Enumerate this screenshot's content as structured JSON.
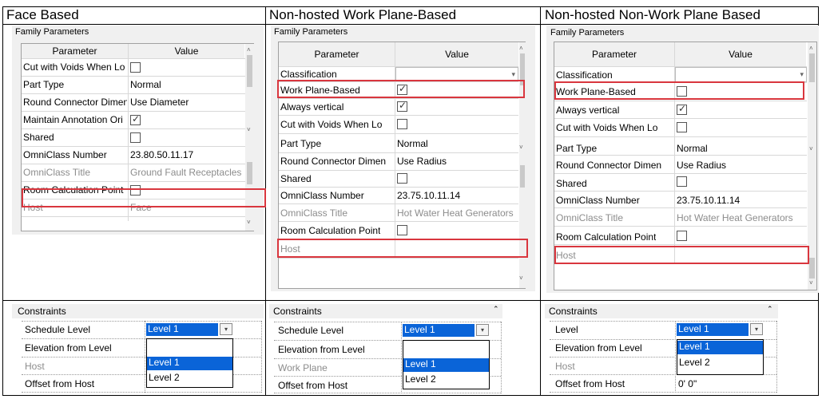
{
  "columns": [
    {
      "heading": "Face Based"
    },
    {
      "heading": "Non-hosted Work Plane-Based"
    },
    {
      "heading": "Non-hosted Non-Work Plane Based"
    }
  ],
  "family_parameters": {
    "panel_title": "Family Parameters",
    "header_parameter": "Parameter",
    "header_value": "Value",
    "check_glyph": "✓",
    "face_based": {
      "rows": [
        {
          "name": "Cut with Voids When Lo",
          "value": "",
          "checkbox": true,
          "checked": false
        },
        {
          "name": "Part Type",
          "value": "Normal"
        },
        {
          "name": "Round Connector Dimen",
          "value": "Use Diameter"
        },
        {
          "name": "Maintain Annotation Ori",
          "value": "",
          "checkbox": true,
          "checked": true
        },
        {
          "name": "Shared",
          "value": "",
          "checkbox": true,
          "checked": false
        },
        {
          "name": "OmniClass Number",
          "value": "23.80.50.11.17"
        },
        {
          "name": "OmniClass Title",
          "value": "Ground Fault Receptacles",
          "grayed": true
        },
        {
          "name": "Room Calculation Point",
          "value": "",
          "checkbox": true,
          "checked": false
        },
        {
          "name": "Host",
          "value": "Face",
          "grayed": true
        }
      ]
    },
    "work_plane_based": {
      "rows": [
        {
          "name": "Classification",
          "value": "",
          "dropdown": true
        },
        {
          "name": "Work Plane-Based",
          "value": "",
          "checkbox": true,
          "checked": true
        },
        {
          "name": "Always vertical",
          "value": "",
          "checkbox": true,
          "checked": true
        },
        {
          "name": "Cut with Voids When Lo",
          "value": "",
          "checkbox": true,
          "checked": false
        },
        {
          "name": "Part Type",
          "value": "Normal"
        },
        {
          "name": "Round Connector Dimen",
          "value": "Use Radius"
        },
        {
          "name": "Shared",
          "value": "",
          "checkbox": true,
          "checked": false
        },
        {
          "name": "OmniClass Number",
          "value": "23.75.10.11.14"
        },
        {
          "name": "OmniClass Title",
          "value": "Hot Water Heat Generators",
          "grayed": true
        },
        {
          "name": "Room Calculation Point",
          "value": "",
          "checkbox": true,
          "checked": false
        },
        {
          "name": "Host",
          "value": "",
          "grayed": true
        }
      ]
    },
    "non_work_plane_based": {
      "rows": [
        {
          "name": "Classification",
          "value": "",
          "dropdown": true
        },
        {
          "name": "Work Plane-Based",
          "value": "",
          "checkbox": true,
          "checked": false
        },
        {
          "name": "Always vertical",
          "value": "",
          "checkbox": true,
          "checked": true
        },
        {
          "name": "Cut with Voids When Lo",
          "value": "",
          "checkbox": true,
          "checked": false
        },
        {
          "name": "Part Type",
          "value": "Normal"
        },
        {
          "name": "Round Connector Dimen",
          "value": "Use Radius"
        },
        {
          "name": "Shared",
          "value": "",
          "checkbox": true,
          "checked": false
        },
        {
          "name": "OmniClass Number",
          "value": "23.75.10.11.14"
        },
        {
          "name": "OmniClass Title",
          "value": "Hot Water Heat Generators",
          "grayed": true
        },
        {
          "name": "Room Calculation Point",
          "value": "",
          "checkbox": true,
          "checked": false
        },
        {
          "name": "Host",
          "value": "",
          "grayed": true
        }
      ]
    }
  },
  "constraints": {
    "title": "Constraints",
    "collapse_glyph": "⌃",
    "dropdown_glyph": "▾",
    "face_based": {
      "labels": [
        "Schedule Level",
        "Elevation from Level",
        "Host",
        "Offset from Host"
      ],
      "selected": "Level 1",
      "options": [
        "Level 1",
        "Level 2"
      ]
    },
    "work_plane_based": {
      "labels": [
        "Schedule Level",
        "Elevation from Level",
        "Work Plane",
        "Offset from Host"
      ],
      "selected": "Level 1",
      "options": [
        "Level 1",
        "Level 2"
      ]
    },
    "non_work_plane_based": {
      "labels": [
        "Level",
        "Elevation from Level",
        "Host",
        "Offset from Host"
      ],
      "selected": "Level 1",
      "options": [
        "Level 1",
        "Level 2"
      ],
      "offset_value": "0'  0\""
    }
  },
  "colors": {
    "highlight": "#d9363e",
    "selection": "#0a64d8"
  }
}
